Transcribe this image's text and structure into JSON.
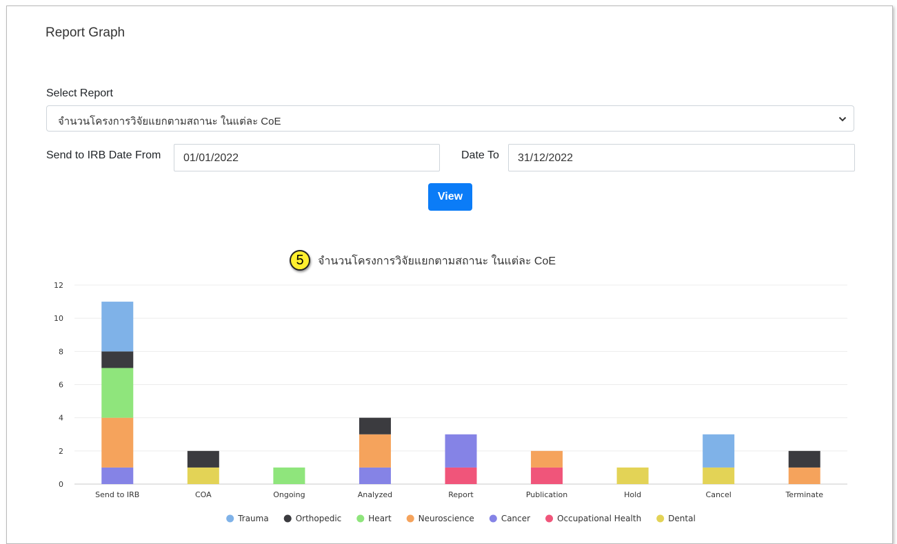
{
  "page": {
    "title": "Report Graph"
  },
  "form": {
    "select_label": "Select Report",
    "select_value": "จำนวนโครงการวิจัยแยกตามสถานะ ในแต่ละ CoE",
    "date_from_label": "Send to IRB Date From",
    "date_from_value": "01/01/2022",
    "date_to_label": "Date To",
    "date_to_value": "31/12/2022",
    "view_button": "View"
  },
  "annotation": {
    "step_number": "5"
  },
  "colors": {
    "Trauma": "#7fb2e8",
    "Orthopedic": "#3b3b3f",
    "Heart": "#8fe57c",
    "Neuroscience": "#f5a35c",
    "Cancer": "#8583e6",
    "Occupational Health": "#f0557a",
    "Dental": "#e3d356",
    "primary_button": "#0b7cf7"
  },
  "chart_data": {
    "type": "bar",
    "stacked": true,
    "title": "จำนวนโครงการวิจัยแยกตามสถานะ ในแต่ละ CoE",
    "categories": [
      "Send to IRB",
      "COA",
      "Ongoing",
      "Analyzed",
      "Report",
      "Publication",
      "Hold",
      "Cancel",
      "Terminate"
    ],
    "ylim": [
      0,
      12
    ],
    "yticks": [
      0,
      2,
      4,
      6,
      8,
      10,
      12
    ],
    "grid": true,
    "legend_position": "bottom",
    "series": [
      {
        "name": "Trauma",
        "values": [
          3,
          0,
          0,
          0,
          0,
          0,
          0,
          2,
          0
        ]
      },
      {
        "name": "Orthopedic",
        "values": [
          1,
          1,
          0,
          1,
          0,
          0,
          0,
          0,
          1
        ]
      },
      {
        "name": "Heart",
        "values": [
          3,
          0,
          1,
          0,
          0,
          0,
          0,
          0,
          0
        ]
      },
      {
        "name": "Neuroscience",
        "values": [
          3,
          0,
          0,
          2,
          0,
          1,
          0,
          0,
          1
        ]
      },
      {
        "name": "Cancer",
        "values": [
          1,
          0,
          0,
          1,
          2,
          0,
          0,
          0,
          0
        ]
      },
      {
        "name": "Occupational Health",
        "values": [
          0,
          0,
          0,
          0,
          1,
          1,
          0,
          0,
          0
        ]
      },
      {
        "name": "Dental",
        "values": [
          0,
          1,
          0,
          0,
          0,
          0,
          1,
          1,
          0
        ]
      }
    ]
  }
}
